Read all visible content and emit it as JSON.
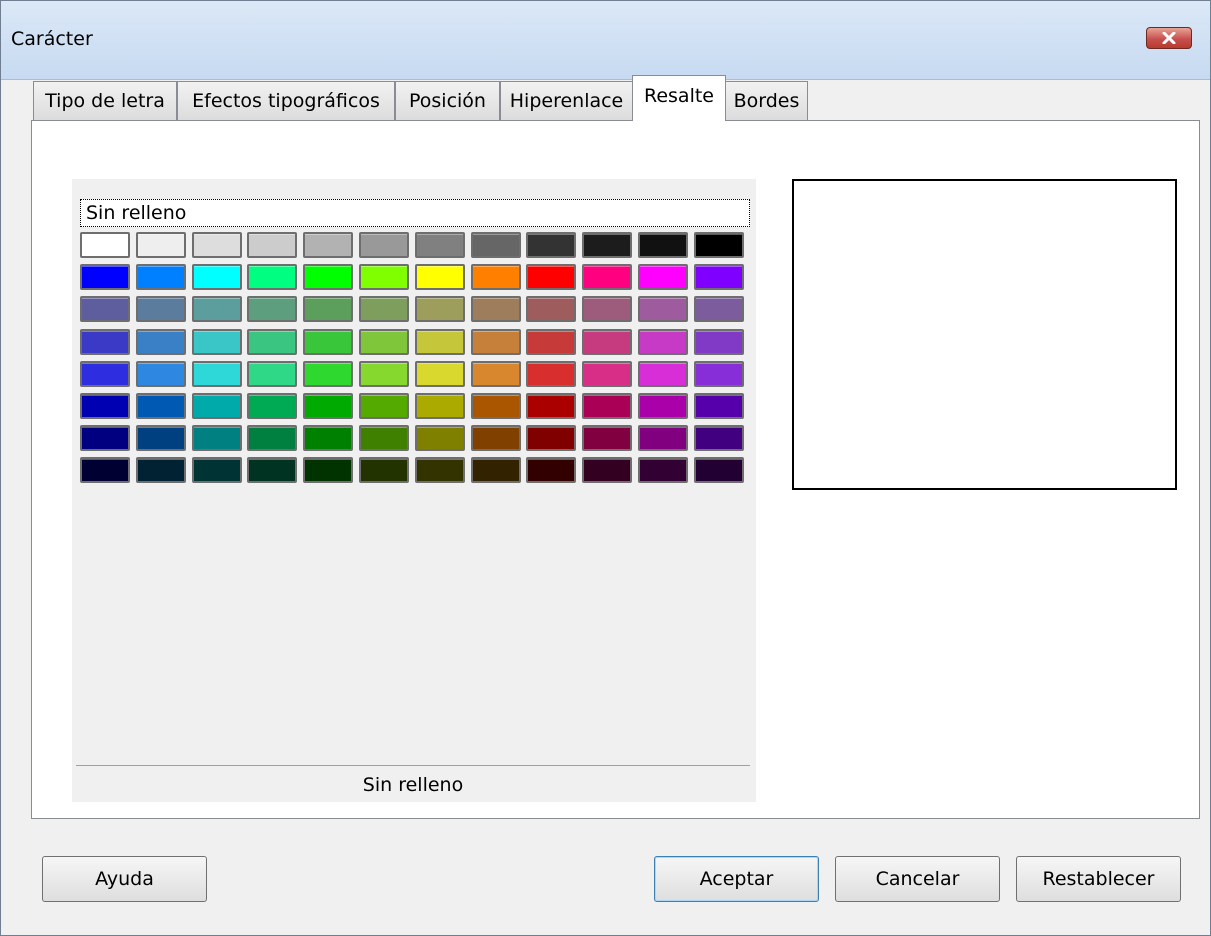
{
  "window": {
    "title": "Carácter"
  },
  "tabs": [
    {
      "label": "Tipo de letra"
    },
    {
      "label": "Efectos tipográficos"
    },
    {
      "label": "Posición"
    },
    {
      "label": "Hiperenlace"
    },
    {
      "label": "Resalte",
      "active": true
    },
    {
      "label": "Bordes"
    }
  ],
  "highlight": {
    "no_fill_label": "Sin relleno",
    "selected_color_name": "Sin relleno",
    "palette": [
      [
        "#FFFFFF",
        "#EEEEEE",
        "#DDDDDD",
        "#CCCCCC",
        "#B2B2B2",
        "#999999",
        "#808080",
        "#666666",
        "#333333",
        "#1C1C1C",
        "#111111",
        "#000000"
      ],
      [
        "#0000FF",
        "#0080FF",
        "#00FFFF",
        "#00FF80",
        "#00FF00",
        "#80FF00",
        "#FFFF00",
        "#FF8000",
        "#FF0000",
        "#FF0080",
        "#FF00FF",
        "#8000FF"
      ],
      [
        "#5E5E9E",
        "#5C7C9E",
        "#5C9E9E",
        "#5C9E7D",
        "#5C9E5C",
        "#7D9E5C",
        "#9E9E5C",
        "#9E7D5C",
        "#9E5C5C",
        "#9E5C7D",
        "#9E5C9E",
        "#7D5C9E"
      ],
      [
        "#3A3AC6",
        "#3A80C6",
        "#3AC6C6",
        "#3AC680",
        "#3AC63A",
        "#80C63A",
        "#C6C63A",
        "#C6803A",
        "#C63A3A",
        "#C63A80",
        "#C63AC6",
        "#803AC6"
      ],
      [
        "#2E2EE0",
        "#2E87E0",
        "#2ED8D8",
        "#2ED887",
        "#2ED82E",
        "#87D82E",
        "#D8D82E",
        "#D8872E",
        "#D82E2E",
        "#D82E87",
        "#D82ED8",
        "#872ED8"
      ],
      [
        "#0000B3",
        "#0059B3",
        "#00AAAA",
        "#00AA55",
        "#00AA00",
        "#55AA00",
        "#AAAA00",
        "#AA5500",
        "#AA0000",
        "#AA0055",
        "#AA00AA",
        "#5500AA"
      ],
      [
        "#000080",
        "#004080",
        "#008080",
        "#008040",
        "#008000",
        "#408000",
        "#808000",
        "#804000",
        "#800000",
        "#800040",
        "#800080",
        "#400080"
      ],
      [
        "#000033",
        "#002233",
        "#003333",
        "#003322",
        "#003300",
        "#223300",
        "#333300",
        "#332200",
        "#330000",
        "#330022",
        "#330033",
        "#220033"
      ]
    ]
  },
  "buttons": {
    "help": "Ayuda",
    "ok": "Aceptar",
    "cancel": "Cancelar",
    "reset": "Restablecer"
  },
  "colors": {
    "titlebar": "#C7DAF1",
    "close_button": "#C75050",
    "default_button_border": "#3C7FB1"
  }
}
